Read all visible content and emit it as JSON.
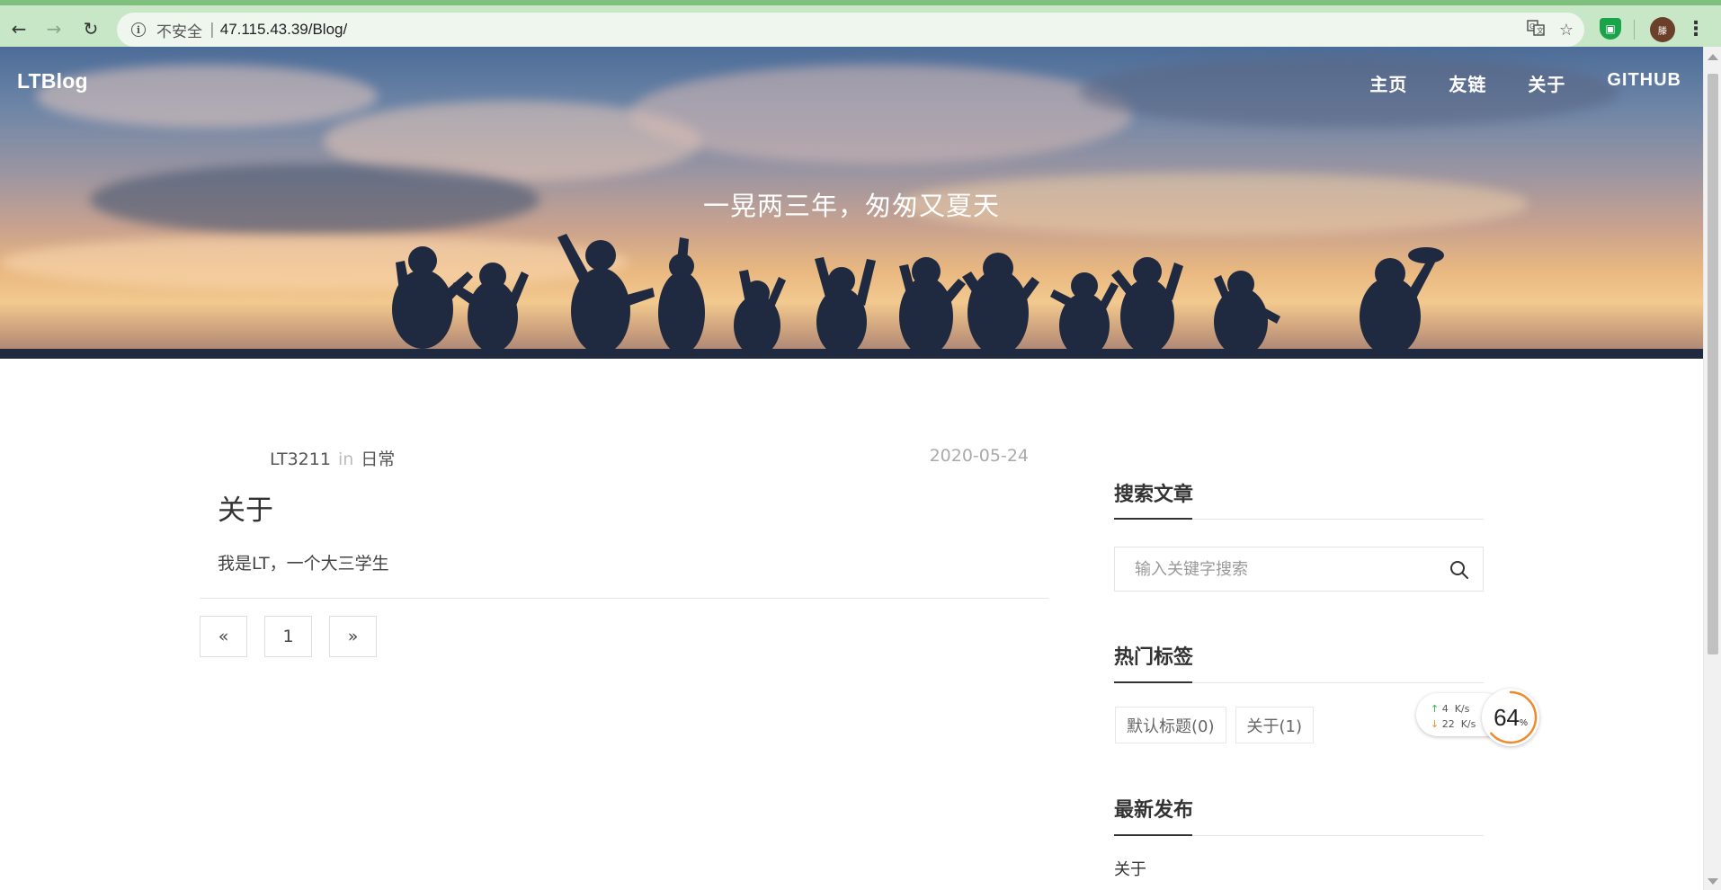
{
  "browser": {
    "security_label": "不安全",
    "separator": "|",
    "url": "47.115.43.39/Blog/",
    "avatar_initial": "滕"
  },
  "site": {
    "brand": "LTBlog",
    "nav": [
      "主页",
      "友链",
      "关于",
      "GITHUB"
    ],
    "tagline": "一晃两三年，匆匆又夏天"
  },
  "post": {
    "author": "LT3211",
    "in_word": "in",
    "category": "日常",
    "date": "2020-05-24",
    "title": "关于",
    "excerpt": "我是LT，一个大三学生"
  },
  "pagination": {
    "prev": "«",
    "current": "1",
    "next": "»"
  },
  "sidebar": {
    "search_title": "搜索文章",
    "search_placeholder": "输入关键字搜索",
    "tags_title": "热门标签",
    "tags": [
      "默认标题(0)",
      "关于(1)"
    ],
    "latest_title": "最新发布",
    "latest": [
      "关于"
    ]
  },
  "speed_widget": {
    "upload": "4",
    "download": "22",
    "unit": "K/s",
    "percent": "64",
    "percent_sign": "%"
  },
  "colors": {
    "chrome_bg": "#c7e7c7",
    "chrome_accent": "#7fc07f",
    "ring": "#f08a2a"
  }
}
